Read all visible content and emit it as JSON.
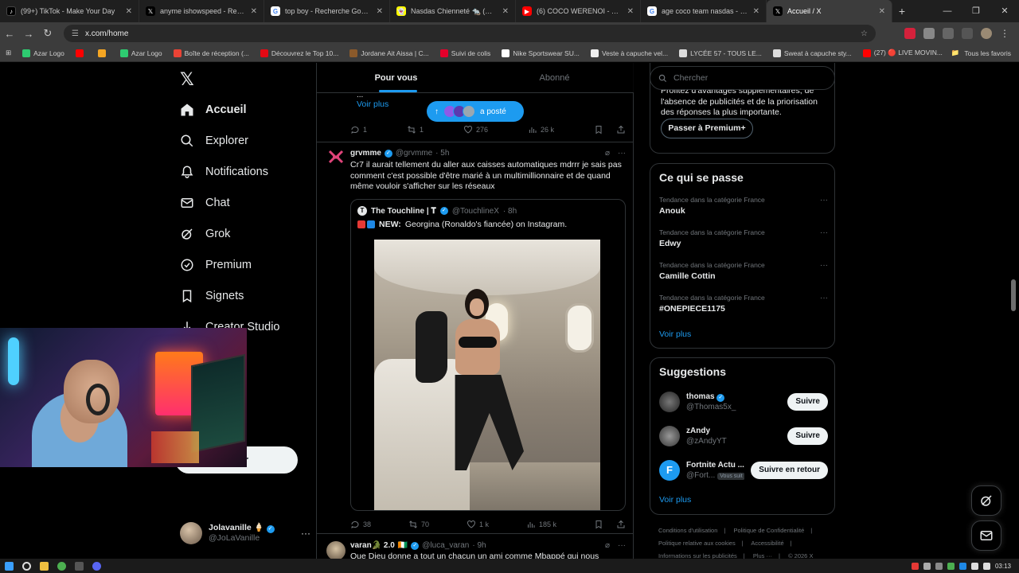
{
  "browser": {
    "tabs": [
      {
        "label": "(99+) TikTok - Make Your Day",
        "icon": "tiktok-icon",
        "color": "#000000"
      },
      {
        "label": "anyme ishowspeed - Recherche",
        "icon": "x-icon",
        "color": "#000000"
      },
      {
        "label": "top boy - Recherche Google",
        "icon": "google-icon",
        "color": "#4285f4"
      },
      {
        "label": "Nasdas Chienneté 🐀 (@nasdas",
        "icon": "snapchat-icon",
        "color": "#fffc00"
      },
      {
        "label": "(6) COCO WERENOI - YouTube",
        "icon": "youtube-icon",
        "color": "#ff0000"
      },
      {
        "label": "age coco team nasdas - Reche",
        "icon": "google-icon",
        "color": "#4285f4"
      },
      {
        "label": "Accueil / X",
        "icon": "x-icon",
        "color": "#000000",
        "active": true
      }
    ],
    "url": "x.com/home",
    "bookmarks": [
      {
        "label": "Azar Logo",
        "color": "#2ecc71"
      },
      {
        "label": "",
        "color": "#ff0000"
      },
      {
        "label": "",
        "color": "#f5a623"
      },
      {
        "label": "Azar Logo",
        "color": "#2ecc71"
      },
      {
        "label": "Boîte de réception (...",
        "color": "#ea4335"
      },
      {
        "label": "Découvrez le Top 10...",
        "color": "#e50914"
      },
      {
        "label": "Jordane Ait Aissa | C...",
        "color": "#8b5a2b"
      },
      {
        "label": "Suivi de colis",
        "color": "#e4002b"
      },
      {
        "label": "Nike Sportswear SU...",
        "color": "#ffffff"
      },
      {
        "label": "Veste à capuche vel...",
        "color": "#eeeeee"
      },
      {
        "label": "LYCÉE 57 - TOUS LE...",
        "color": "#dddddd"
      },
      {
        "label": "Sweat à capuche sty...",
        "color": "#dddddd"
      },
      {
        "label": "(27) 🔴 LIVE MOVIN...",
        "color": "#ff0000"
      }
    ],
    "all_bookmarks": "Tous les favoris"
  },
  "nav": {
    "items": [
      {
        "label": "Accueil",
        "icon": "home-icon",
        "active": true
      },
      {
        "label": "Explorer",
        "icon": "search-icon"
      },
      {
        "label": "Notifications",
        "icon": "bell-icon"
      },
      {
        "label": "Chat",
        "icon": "mail-icon"
      },
      {
        "label": "Grok",
        "icon": "grok-icon"
      },
      {
        "label": "Premium",
        "icon": "premium-icon"
      },
      {
        "label": "Signets",
        "icon": "bookmark-icon"
      },
      {
        "label": "Creator Studio",
        "icon": "creator-studio-icon"
      }
    ],
    "post_button_fragment": "r",
    "account": {
      "name": "Jolavanille 🍦",
      "handle": "@JoLaVanille"
    }
  },
  "feed": {
    "tabs": [
      "Pour vous",
      "Abonné"
    ],
    "prev_tweet": {
      "ellipsis": "...",
      "voir_plus": "Voir plus",
      "stats": {
        "replies": "1",
        "retweets": "1",
        "likes": "276",
        "views": "26 k"
      }
    },
    "new_posts_pill": "a posté",
    "tweet": {
      "name": "grvmme",
      "handle": "@grvmme",
      "time": "· 5h",
      "text": "Cr7 il aurait tellement du aller aux caisses automatiques mdrrr je sais pas comment c'est possible d'être marié à un multimillionnaire et de quand même vouloir s'afficher sur les réseaux",
      "quote": {
        "name": "The Touchline | 𝐓",
        "handle": "@TouchlineX",
        "time": "· 8h",
        "emoji": "🚨➕",
        "new_label": "NEW:",
        "text": "Georgina (Ronaldo's fiancée) on Instagram."
      },
      "stats": {
        "replies": "38",
        "retweets": "70",
        "likes": "1 k",
        "views": "185 k"
      }
    },
    "next_tweet": {
      "name": "varan🐊 2.0",
      "flag": "🇨🇮",
      "handle": "@luca_varan",
      "time": "· 9h",
      "text": "Que Dieu donne a tout un chacun un ami comme Mbappé qui nous"
    }
  },
  "sidebar": {
    "search_placeholder": "Chercher",
    "premium_text": "Profitez d'avantages supplémentaires, de l'absence de publicités et de la priorisation des réponses la plus importante.",
    "premium_button": "Passer à Premium+",
    "trends_title": "Ce qui se passe",
    "trends": [
      {
        "category": "Tendance dans la catégorie France",
        "name": "Anouk"
      },
      {
        "category": "Tendance dans la catégorie France",
        "name": "Edwy"
      },
      {
        "category": "Tendance dans la catégorie France",
        "name": "Camille Cottin"
      },
      {
        "category": "Tendance dans la catégorie France",
        "name": "#ONEPIECE1175"
      }
    ],
    "trends_more": "Voir plus",
    "suggest_title": "Suggestions",
    "suggestions": [
      {
        "name": "thomas",
        "handle": "@Thomas5x_",
        "button": "Suivre",
        "verified": true,
        "color": "#3a3a3a"
      },
      {
        "name": "zAndy",
        "handle": "@zAndyYT",
        "button": "Suivre",
        "verified": false,
        "color": "#555555"
      },
      {
        "name": "Fortnite Actu ...",
        "handle": "@Fort...",
        "badge": "Vous suit",
        "button": "Suivre en retour",
        "verified": false,
        "color": "#1d9bf0"
      }
    ],
    "suggest_more": "Voir plus",
    "footer": [
      "Conditions d'utilisation",
      "Politique de Confidentialité",
      "Politique relative aux cookies",
      "Accessibilité",
      "Informations sur les publicités",
      "Plus ···",
      "© 2026 X Corp."
    ]
  },
  "taskbar": {
    "time": "03:13"
  }
}
